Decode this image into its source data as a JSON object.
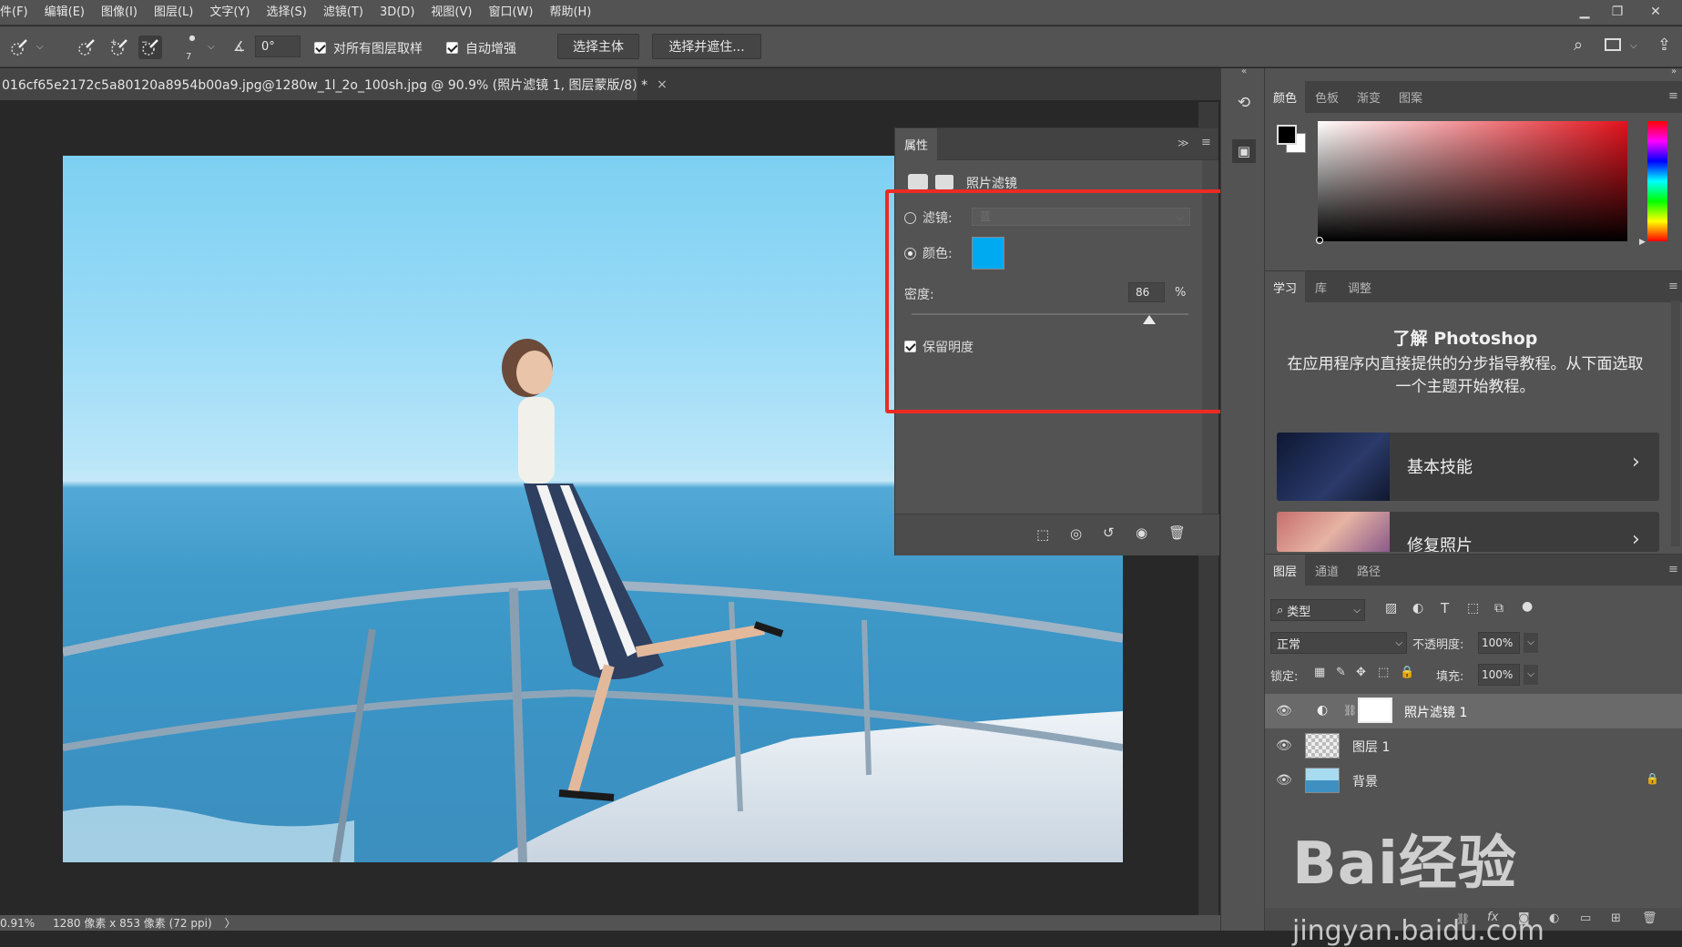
{
  "menu": {
    "items": [
      "件(F)",
      "编辑(E)",
      "图像(I)",
      "图层(L)",
      "文字(Y)",
      "选择(S)",
      "滤镜(T)",
      "3D(D)",
      "视图(V)",
      "窗口(W)",
      "帮助(H)"
    ]
  },
  "options_bar": {
    "brush_size": "7",
    "angle_value": "0°",
    "sample_all_label": "对所有图层取样",
    "auto_enhance_label": "自动增强",
    "select_subject_label": "选择主体",
    "select_mask_label": "选择并遮住..."
  },
  "document_tab": {
    "title": "016cf65e2172c5a80120a8954b00a9.jpg@1280w_1l_2o_100sh.jpg @ 90.9% (照片滤镜 1, 图层蒙版/8) *",
    "close_glyph": "×"
  },
  "status_bar": {
    "zoom": "0.91%",
    "doc_size": "1280 像素 x 853 像素 (72 ppi)",
    "arrow": "〉"
  },
  "properties_panel": {
    "tab_label": "属性",
    "header_label": "照片滤镜",
    "filter_label": "滤镜:",
    "filter_value": "蓝",
    "color_label": "颜色:",
    "color_swatch": "#00aaf0",
    "density_label": "密度:",
    "density_value": "86",
    "density_unit": "%",
    "density_fraction": 0.86,
    "preserve_label": "保留明度",
    "highlight_color": "#ee2b22"
  },
  "color_panel": {
    "tabs": [
      "颜色",
      "色板",
      "渐变",
      "图案"
    ],
    "foreground": "#000000",
    "background": "#ffffff",
    "hue_base": "#e3121c"
  },
  "learn_panel": {
    "tabs": [
      "学习",
      "库",
      "调整"
    ],
    "title": "了解 Photoshop",
    "description": "在应用程序内直接提供的分步指导教程。从下面选取一个主题开始教程。",
    "cards": [
      {
        "label": "基本技能"
      },
      {
        "label": "修复照片"
      }
    ]
  },
  "layers_panel": {
    "tabs": [
      "图层",
      "通道",
      "路径"
    ],
    "filter_kind": "类型",
    "blend_mode": "正常",
    "opacity_label": "不透明度:",
    "opacity_value": "100%",
    "lock_label": "锁定:",
    "fill_label": "填充:",
    "fill_value": "100%",
    "layers": [
      {
        "name": "照片滤镜 1"
      },
      {
        "name": "图层 1"
      },
      {
        "name": "背景"
      }
    ]
  },
  "watermark": {
    "text": "Bai经验",
    "url": "jingyan.baidu.com"
  }
}
